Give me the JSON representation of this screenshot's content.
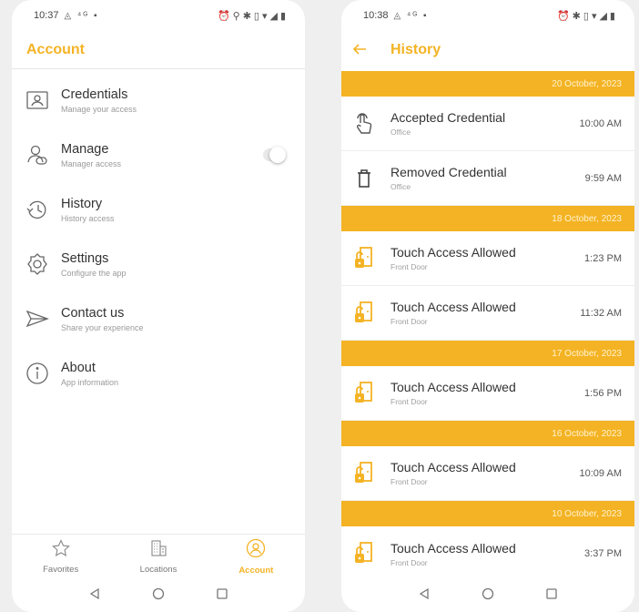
{
  "left_screen": {
    "status": {
      "time": "10:37"
    },
    "header": {
      "title": "Account"
    },
    "menu": [
      {
        "title": "Credentials",
        "subtitle": "Manage your access",
        "icon": "credentials-icon"
      },
      {
        "title": "Manage",
        "subtitle": "Manager access",
        "icon": "manager-icon",
        "toggle": "off"
      },
      {
        "title": "History",
        "subtitle": "History access",
        "icon": "history-icon"
      },
      {
        "title": "Settings",
        "subtitle": "Configure the app",
        "icon": "settings-icon"
      },
      {
        "title": "Contact us",
        "subtitle": "Share your experience",
        "icon": "send-icon"
      },
      {
        "title": "About",
        "subtitle": "App information",
        "icon": "info-icon"
      }
    ],
    "bottom_nav": [
      {
        "label": "Favorites",
        "icon": "star-icon",
        "active": false
      },
      {
        "label": "Locations",
        "icon": "building-icon",
        "active": false
      },
      {
        "label": "Account",
        "icon": "account-icon",
        "active": true
      }
    ]
  },
  "right_screen": {
    "status": {
      "time": "10:38"
    },
    "header": {
      "title": "History",
      "back_icon": "arrow-left-icon"
    },
    "groups": [
      {
        "date": "20 October, 2023",
        "items": [
          {
            "title": "Accepted Credential",
            "subtitle": "Office",
            "time": "10:00 AM",
            "icon": "touch-icon"
          },
          {
            "title": "Removed Credential",
            "subtitle": "Office",
            "time": "9:59 AM",
            "icon": "trash-icon"
          }
        ]
      },
      {
        "date": "18 October, 2023",
        "items": [
          {
            "title": "Touch Access Allowed",
            "subtitle": "Front Door",
            "time": "1:23 PM",
            "icon": "door-unlock-icon"
          },
          {
            "title": "Touch Access Allowed",
            "subtitle": "Front Door",
            "time": "11:32 AM",
            "icon": "door-unlock-icon"
          }
        ]
      },
      {
        "date": "17 October, 2023",
        "items": [
          {
            "title": "Touch Access Allowed",
            "subtitle": "Front Door",
            "time": "1:56 PM",
            "icon": "door-unlock-icon"
          }
        ]
      },
      {
        "date": "16 October, 2023",
        "items": [
          {
            "title": "Touch Access Allowed",
            "subtitle": "Front Door",
            "time": "10:09 AM",
            "icon": "door-unlock-icon"
          }
        ]
      },
      {
        "date": "10 October, 2023",
        "items": [
          {
            "title": "Touch Access Allowed",
            "subtitle": "Front Door",
            "time": "3:37 PM",
            "icon": "door-unlock-icon"
          }
        ]
      }
    ]
  },
  "colors": {
    "accent": "#f4b324",
    "background": "#efefef",
    "text": "#333333",
    "muted": "#9a9a9a"
  }
}
